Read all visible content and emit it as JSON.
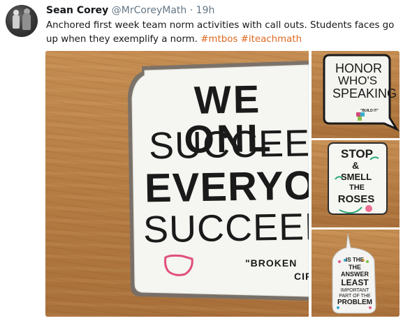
{
  "tweet": {
    "author_name": "Sean Corey",
    "author_handle": "@MrCoreyMath",
    "separator": "·",
    "time": "19h",
    "text_plain": "Anchored first week team norm activities with call outs. Students faces go up when they exemplify a norm.",
    "hashtags": [
      "#mtbos",
      "#iteachmath"
    ]
  },
  "media": {
    "main_photo": {
      "lines": [
        "WE ONL",
        "SUCCEED",
        "EVERYON",
        "SUCCEED",
        "\"BROKEN",
        "CIR"
      ]
    },
    "photo_top": {
      "lines": [
        "HONOR",
        "WHO'S",
        "SPEAKING",
        "\"BUILD IT\""
      ]
    },
    "photo_middle": {
      "lines": [
        "STOP",
        "&",
        "SMELL",
        "THE",
        "ROSES"
      ]
    },
    "photo_bottom": {
      "lines": [
        "THE",
        "ANSWER",
        "IS THE",
        "LEAST",
        "IMPORTANT",
        "PART OF THE",
        "PROBLEM"
      ]
    }
  },
  "colors": {
    "hashtag": "#e0681f",
    "secondary_text": "#657786",
    "primary_text": "#14171a",
    "wood": "#b57c43"
  },
  "icons": {
    "avatar": "profile-photo",
    "pink_shape": "pink-semicircle-drawing"
  }
}
